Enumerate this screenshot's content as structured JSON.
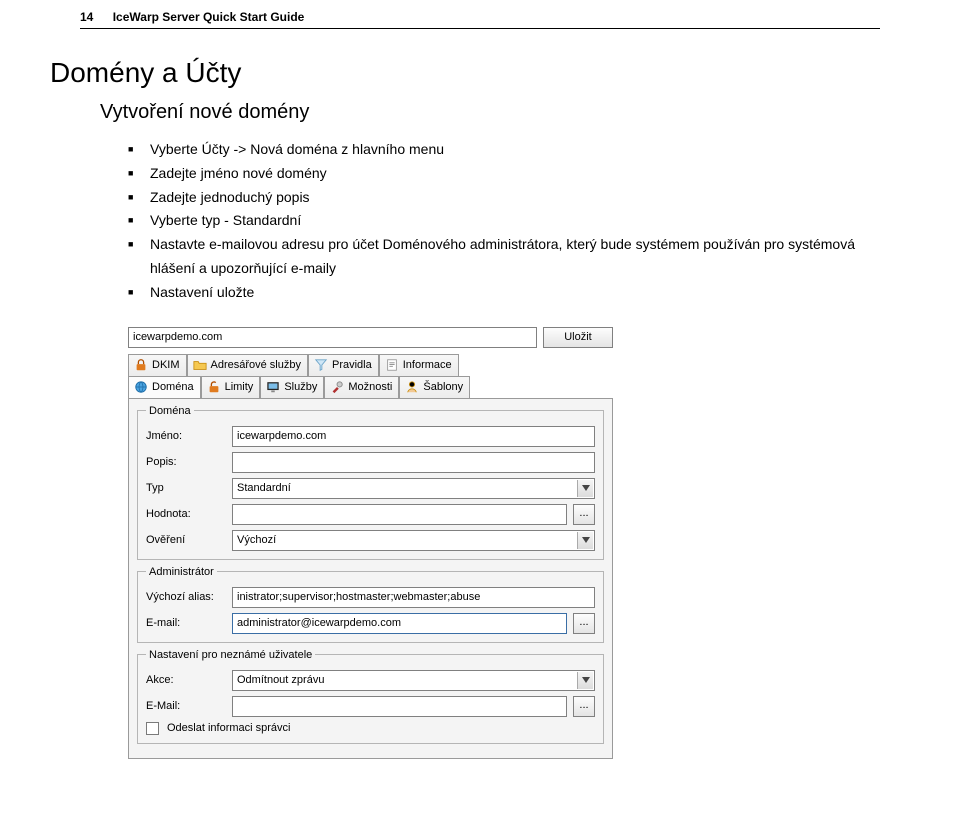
{
  "header": {
    "page_num": "14",
    "title": "IceWarp Server Quick Start Guide"
  },
  "h1": "Domény a Účty",
  "h2": "Vytvoření nové domény",
  "bullets": [
    "Vyberte Účty -> Nová doména z hlavního menu",
    "Zadejte jméno nové domény",
    "Zadejte jednoduchý popis",
    "Vyberte typ - Standardní",
    "Nastavte e-mailovou adresu pro účet Doménového administrátora, který bude systémem používán pro systémová hlášení a upozorňující e-maily",
    "Nastavení uložte"
  ],
  "panel": {
    "domain_top": "icewarpdemo.com",
    "save_btn": "Uložit",
    "tabs_row1": [
      {
        "label": "DKIM",
        "icon": "lock-icon"
      },
      {
        "label": "Adresářové služby",
        "icon": "folder-icon"
      },
      {
        "label": "Pravidla",
        "icon": "funnel-icon"
      },
      {
        "label": "Informace",
        "icon": "info-icon"
      }
    ],
    "tabs_row2": [
      {
        "label": "Doména",
        "icon": "globe-icon",
        "active": true
      },
      {
        "label": "Limity",
        "icon": "lock-open-icon"
      },
      {
        "label": "Služby",
        "icon": "monitor-icon"
      },
      {
        "label": "Možnosti",
        "icon": "tools-icon"
      },
      {
        "label": "Šablony",
        "icon": "user-icon"
      }
    ],
    "groups": {
      "domena": {
        "legend": "Doména",
        "jmeno_lbl": "Jméno:",
        "jmeno_val": "icewarpdemo.com",
        "popis_lbl": "Popis:",
        "popis_val": "",
        "typ_lbl": "Typ",
        "typ_val": "Standardní",
        "hodnota_lbl": "Hodnota:",
        "hodnota_val": "",
        "overeni_lbl": "Ověření",
        "overeni_val": "Výchozí"
      },
      "admin": {
        "legend": "Administrátor",
        "alias_lbl": "Výchozí alias:",
        "alias_val": "inistrator;supervisor;hostmaster;webmaster;abuse",
        "email_lbl": "E-mail:",
        "email_val": "administrator@icewarpdemo.com"
      },
      "unknown": {
        "legend": "Nastavení pro neznámé uživatele",
        "akce_lbl": "Akce:",
        "akce_val": "Odmítnout zprávu",
        "email_lbl": "E-Mail:",
        "email_val": "",
        "odeslat_lbl": "Odeslat informaci správci"
      }
    }
  }
}
